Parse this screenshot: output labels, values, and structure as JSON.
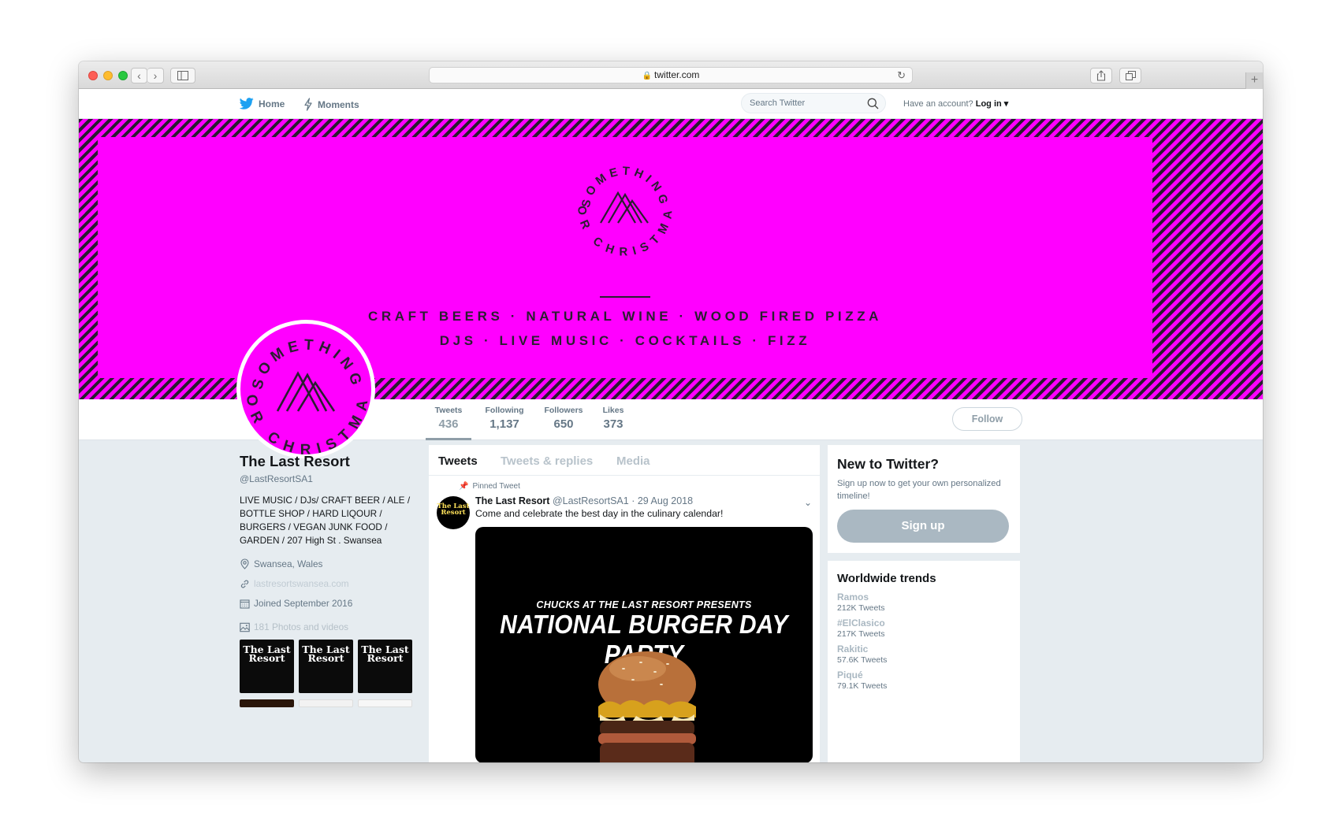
{
  "browser": {
    "url": "twitter.com"
  },
  "topnav": {
    "home_label": "Home",
    "moments_label": "Moments",
    "search_placeholder": "Search Twitter",
    "account_prompt": "Have an account?",
    "login_label": "Log in"
  },
  "banner": {
    "badge_top_arc": "SOMETHING",
    "badge_bottom_arc": "FOR CHRISTMAS",
    "line1": "CRAFT BEERS · NATURAL WINE · WOOD FIRED PIZZA",
    "line2": "DJS · LIVE MUSIC · COCKTAILS · FIZZ",
    "colors": {
      "magenta": "#ff00ff",
      "ink": "#2a1e30"
    }
  },
  "stats": [
    {
      "label": "Tweets",
      "value": "436"
    },
    {
      "label": "Following",
      "value": "1,137"
    },
    {
      "label": "Followers",
      "value": "650"
    },
    {
      "label": "Likes",
      "value": "373"
    }
  ],
  "follow_label": "Follow",
  "profile": {
    "name": "The Last Resort",
    "handle": "@LastResortSA1",
    "bio": "LIVE MUSIC / DJs/ CRAFT BEER / ALE / BOTTLE SHOP / HARD LIQOUR / BURGERS / VEGAN JUNK FOOD / GARDEN / 207 High St . Swansea",
    "location": "Swansea, Wales",
    "website": "lastresortswansea.com",
    "joined": "Joined September 2016",
    "photos": "181 Photos and videos",
    "thumb_title": "The Last Resort"
  },
  "timeline": {
    "tabs": [
      "Tweets",
      "Tweets & replies",
      "Media"
    ],
    "pinned_label": "Pinned Tweet",
    "tweet": {
      "author": "The Last Resort",
      "handle": "@LastResortSA1",
      "date": "· 29 Aug 2018",
      "text": "Come and celebrate the best day in the culinary calendar!",
      "avatar_text": "The Last Resort",
      "media_subtitle": "CHUCKS AT THE LAST RESORT PRESENTS",
      "media_title": "NATIONAL BURGER DAY PARTY"
    }
  },
  "signup": {
    "title": "New to Twitter?",
    "text": "Sign up now to get your own personalized timeline!",
    "button": "Sign up"
  },
  "trends": {
    "title": "Worldwide trends",
    "items": [
      {
        "name": "Ramos",
        "count": "212K Tweets"
      },
      {
        "name": "#ElClasico",
        "count": "217K Tweets"
      },
      {
        "name": "Rakitic",
        "count": "57.6K Tweets"
      },
      {
        "name": "Piqué",
        "count": "79.1K Tweets"
      }
    ]
  }
}
